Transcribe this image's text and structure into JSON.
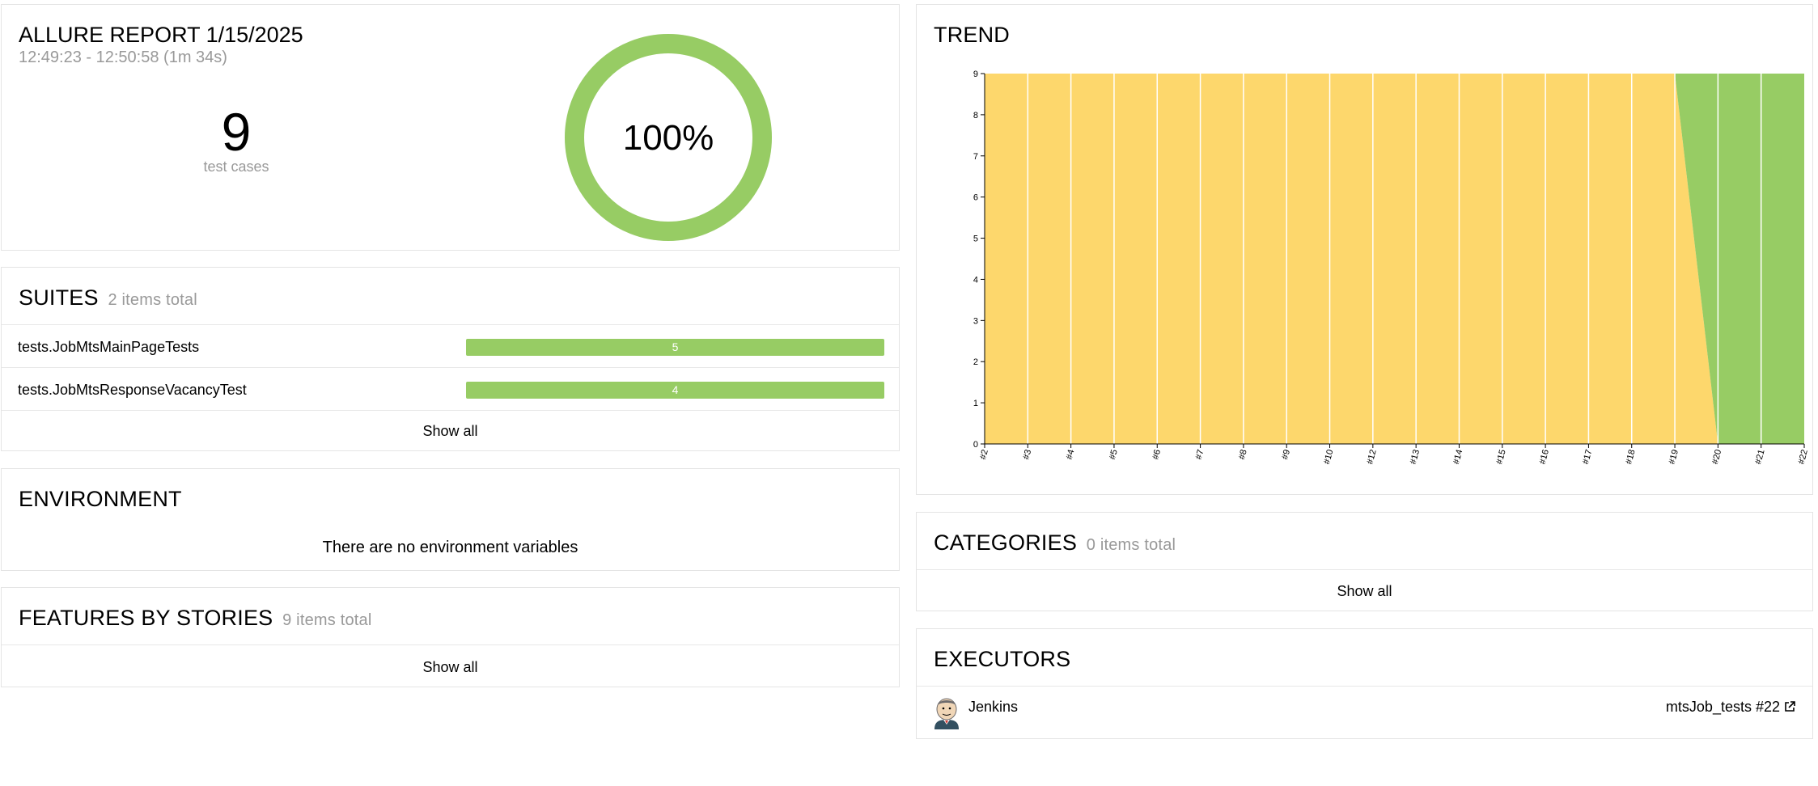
{
  "summary": {
    "title": "ALLURE REPORT 1/15/2025",
    "time": "12:49:23 - 12:50:58 (1m 34s)",
    "test_count": "9",
    "test_label": "test cases",
    "percent_text": "100%",
    "pass_rate": 1.0,
    "color": "#97cc64"
  },
  "suites": {
    "title": "SUITES",
    "count": "2 items total",
    "items": [
      {
        "name": "tests.JobMtsMainPageTests",
        "count": "5"
      },
      {
        "name": "tests.JobMtsResponseVacancyTest",
        "count": "4"
      }
    ],
    "show_all": "Show all"
  },
  "environment": {
    "title": "ENVIRONMENT",
    "empty_text": "There are no environment variables"
  },
  "features": {
    "title": "FEATURES BY STORIES",
    "count": "9 items total",
    "show_all": "Show all"
  },
  "trend": {
    "title": "TREND"
  },
  "chart_data": {
    "type": "area",
    "x": [
      "#2",
      "#3",
      "#4",
      "#5",
      "#6",
      "#7",
      "#8",
      "#9",
      "#10",
      "#12",
      "#13",
      "#14",
      "#15",
      "#16",
      "#17",
      "#18",
      "#19",
      "#20",
      "#21",
      "#22"
    ],
    "yticks": [
      0,
      1,
      2,
      3,
      4,
      5,
      6,
      7,
      8,
      9
    ],
    "ylim": [
      0,
      9
    ],
    "series": [
      {
        "status": "unknown",
        "color": "#fdd76c",
        "values": [
          9,
          9,
          9,
          9,
          9,
          9,
          9,
          9,
          9,
          9,
          9,
          9,
          9,
          9,
          9,
          9,
          9,
          0,
          0,
          0
        ]
      },
      {
        "status": "passed",
        "color": "#97cc64",
        "values": [
          0,
          0,
          0,
          0,
          0,
          0,
          0,
          0,
          0,
          0,
          0,
          0,
          0,
          0,
          0,
          0,
          0,
          9,
          9,
          9
        ]
      }
    ]
  },
  "categories": {
    "title": "CATEGORIES",
    "count": "0 items total",
    "show_all": "Show all"
  },
  "executors": {
    "title": "EXECUTORS",
    "name": "Jenkins",
    "build": "mtsJob_tests #22",
    "avatar_icon": "jenkins-avatar-icon",
    "link_icon": "external-link-icon"
  }
}
